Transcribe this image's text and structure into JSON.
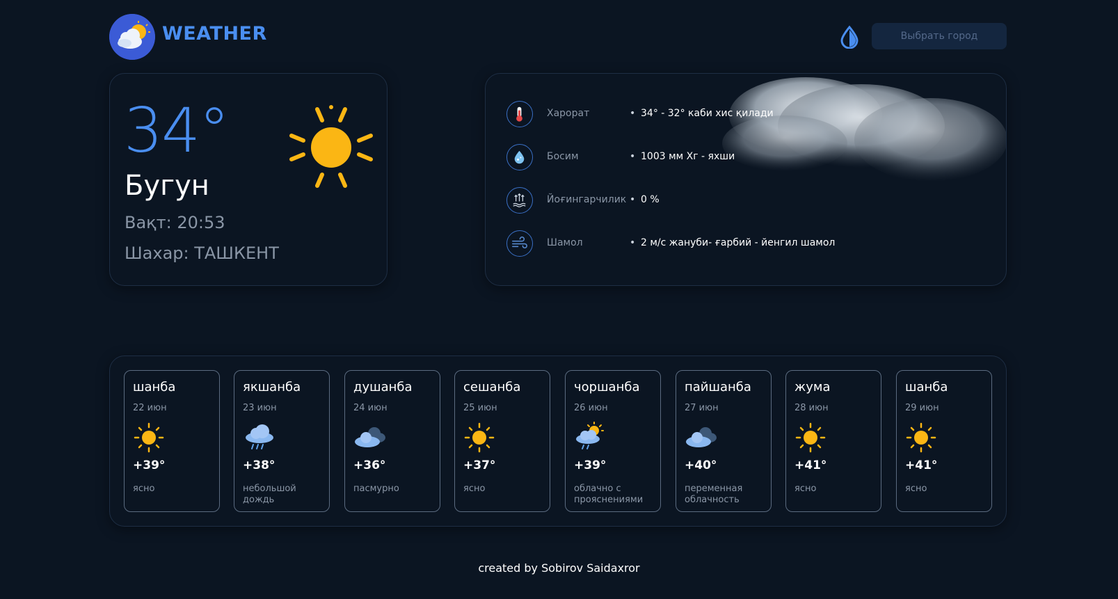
{
  "header": {
    "title": "WEATHER",
    "city_button": "Выбрать город"
  },
  "today": {
    "temperature": "34°",
    "label": "Бугун",
    "time": "Вақт: 20:53",
    "city": "Шахар: ТАШКЕНТ",
    "icon": "sun-icon"
  },
  "details": [
    {
      "icon": "thermometer-icon",
      "label": "Харорат",
      "value": "34° - 32° каби хис қилади"
    },
    {
      "icon": "pressure-drop-icon",
      "label": "Босим",
      "value": "1003 мм Хг - яхши"
    },
    {
      "icon": "precipitation-icon",
      "label": "Йоғингарчилик",
      "value": "0 %"
    },
    {
      "icon": "wind-icon",
      "label": "Шамол",
      "value": "2 м/с жануби- ғарбий - йенгил шамол"
    }
  ],
  "forecast": [
    {
      "day": "шанба",
      "date": "22 июн",
      "icon": "sun-icon",
      "temp": "+39°",
      "desc": "ясно"
    },
    {
      "day": "якшанба",
      "date": "23 июн",
      "icon": "rain-cloud-icon",
      "temp": "+38°",
      "desc": "небольшой дождь"
    },
    {
      "day": "душанба",
      "date": "24 июн",
      "icon": "overcast-cloud-icon",
      "temp": "+36°",
      "desc": "пасмурно"
    },
    {
      "day": "сешанба",
      "date": "25 июн",
      "icon": "sun-icon",
      "temp": "+37°",
      "desc": "ясно"
    },
    {
      "day": "чоршанба",
      "date": "26 июн",
      "icon": "sun-rain-cloud-icon",
      "temp": "+39°",
      "desc": "облачно с прояснениями"
    },
    {
      "day": "пайшанба",
      "date": "27 июн",
      "icon": "overcast-cloud-icon",
      "temp": "+40°",
      "desc": "переменная облачность"
    },
    {
      "day": "жума",
      "date": "28 июн",
      "icon": "sun-icon",
      "temp": "+41°",
      "desc": "ясно"
    },
    {
      "day": "шанба",
      "date": "29 июн",
      "icon": "sun-icon",
      "temp": "+41°",
      "desc": "ясно"
    }
  ],
  "footer": "created by Sobirov Saidaxror",
  "colors": {
    "background": "#0b1522",
    "accent": "#4a8ef0",
    "sun": "#fbb614"
  }
}
